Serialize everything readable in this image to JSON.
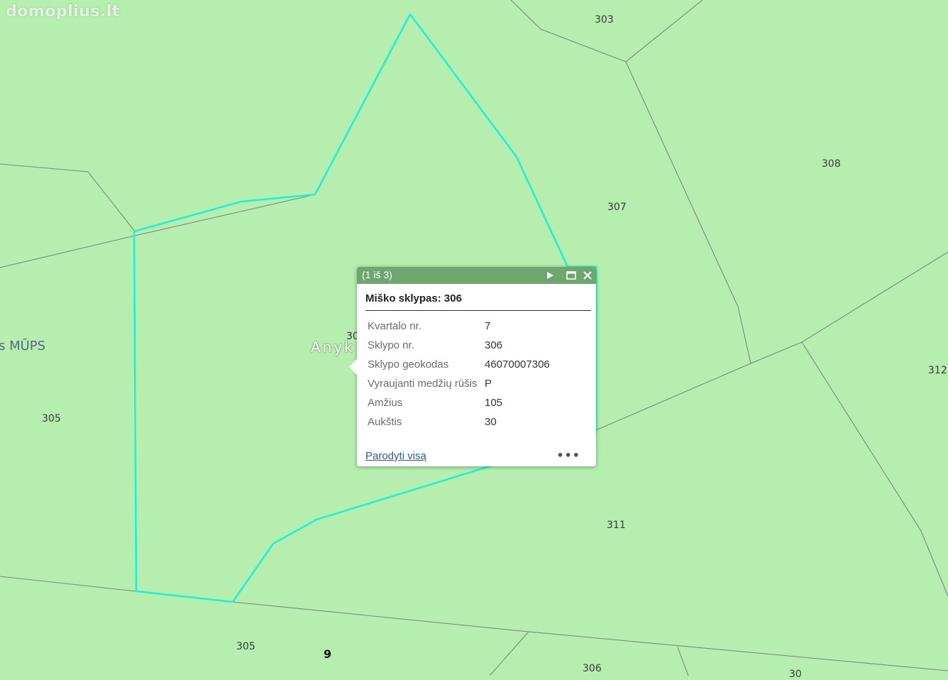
{
  "watermark": "domoplius.lt",
  "colors": {
    "map_bg": "#b5eeae",
    "highlight": "#21f0d6",
    "boundary": "#7a8a7a",
    "popup_header": "#6ea66e"
  },
  "map": {
    "parcel_labels": [
      "303",
      "308",
      "307",
      "312",
      "305",
      "311",
      "305",
      "306",
      "30",
      "30"
    ],
    "quarter_label": "9",
    "place_labels": {
      "left": "s MŪPS",
      "center": "Anyk"
    }
  },
  "popup": {
    "counter": "(1 iš 3)",
    "icons": [
      "play-icon",
      "maximize-icon",
      "close-icon"
    ],
    "title": "Miško sklypas: 306",
    "rows": [
      {
        "key": "Kvartalo nr.",
        "value": "7"
      },
      {
        "key": "Sklypo nr.",
        "value": "306"
      },
      {
        "key": "Sklypo geokodas",
        "value": "46070007306"
      },
      {
        "key": "Vyraujanti medžių rūšis",
        "value": "P"
      },
      {
        "key": "Amžius",
        "value": "105"
      },
      {
        "key": "Aukštis",
        "value": "30"
      }
    ],
    "link": "Parodyti visą",
    "more": "•••"
  }
}
